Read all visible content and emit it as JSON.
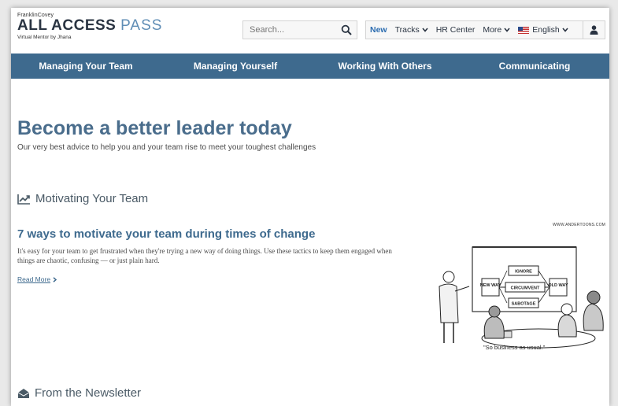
{
  "header": {
    "brand_small": "FranklinCovey",
    "brand_main": "ALL ACCESS",
    "brand_pass": "PASS",
    "brand_sub": "Virtual Mentor by Jhana",
    "search_placeholder": "Search...",
    "nav": [
      {
        "label": "New"
      },
      {
        "label": "Tracks"
      },
      {
        "label": "HR Center"
      },
      {
        "label": "More"
      },
      {
        "label": "English"
      }
    ]
  },
  "categories": [
    {
      "label": "Managing Your Team"
    },
    {
      "label": "Managing Yourself"
    },
    {
      "label": "Working With Others"
    },
    {
      "label": "Communicating"
    }
  ],
  "hero": {
    "title": "Become a better leader today",
    "subtitle": "Our very best advice to help you and your team rise to meet your toughest challenges"
  },
  "sections": [
    {
      "title": "Motivating Your Team",
      "icon": "trending-up-icon"
    },
    {
      "title": "From the Newsletter",
      "icon": "open-envelope-icon"
    }
  ],
  "article": {
    "title": "7 ways to motivate your team during times of change",
    "body": "It's easy for your team to get frustrated when they're trying a new way of doing things. Use these tactics to keep them engaged when things are chaotic, confusing — or just plain hard.",
    "read_more": "Read More"
  },
  "cartoon": {
    "credit": "WWW.ANDERTOONS.COM",
    "labels": [
      "NEW WAY",
      "IGNORE",
      "CIRCUMVENT",
      "SABOTAGE",
      "OLD WAY"
    ],
    "caption": "\"So business as usual.\""
  },
  "colors": {
    "brand_blue": "#3e6a8e",
    "title_blue": "#4a6d8c",
    "new_link": "#2b6cb0"
  }
}
